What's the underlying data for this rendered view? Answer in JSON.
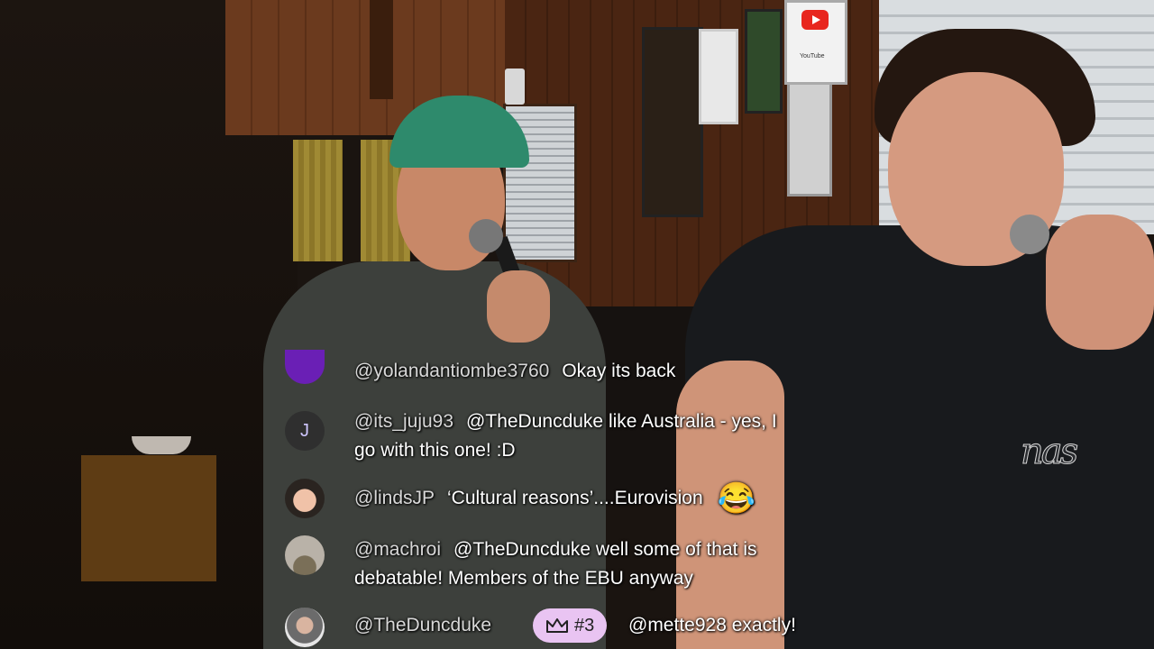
{
  "chat": {
    "messages": [
      {
        "author": "@yolandantiombe3760",
        "text": "Okay its back",
        "avatar_icon": "purple-avatar-icon"
      },
      {
        "author": "@its_juju93",
        "text": "@TheDuncduke like Australia - yes, I",
        "text_line2": "go with this one! :D",
        "avatar_letter": "J"
      },
      {
        "author": "@lindsJP",
        "text": "‘Cultural reasons’....Eurovision",
        "emoji": "😂"
      },
      {
        "author": "@machroi",
        "text": "@TheDuncduke well some of that is",
        "text_line2": "debatable! Members of the EBU anyway"
      },
      {
        "author": "@TheDuncduke",
        "badge": "#3",
        "text": "@mette928 exactly!"
      }
    ]
  },
  "scene": {
    "shirt_logo": "nas",
    "plaque_text": "YouTube"
  },
  "colors": {
    "badge_bg": "#e9c4f2",
    "avatar_purple": "#6a1fb5",
    "avatar_letter_bg": "#2f2f2f"
  }
}
